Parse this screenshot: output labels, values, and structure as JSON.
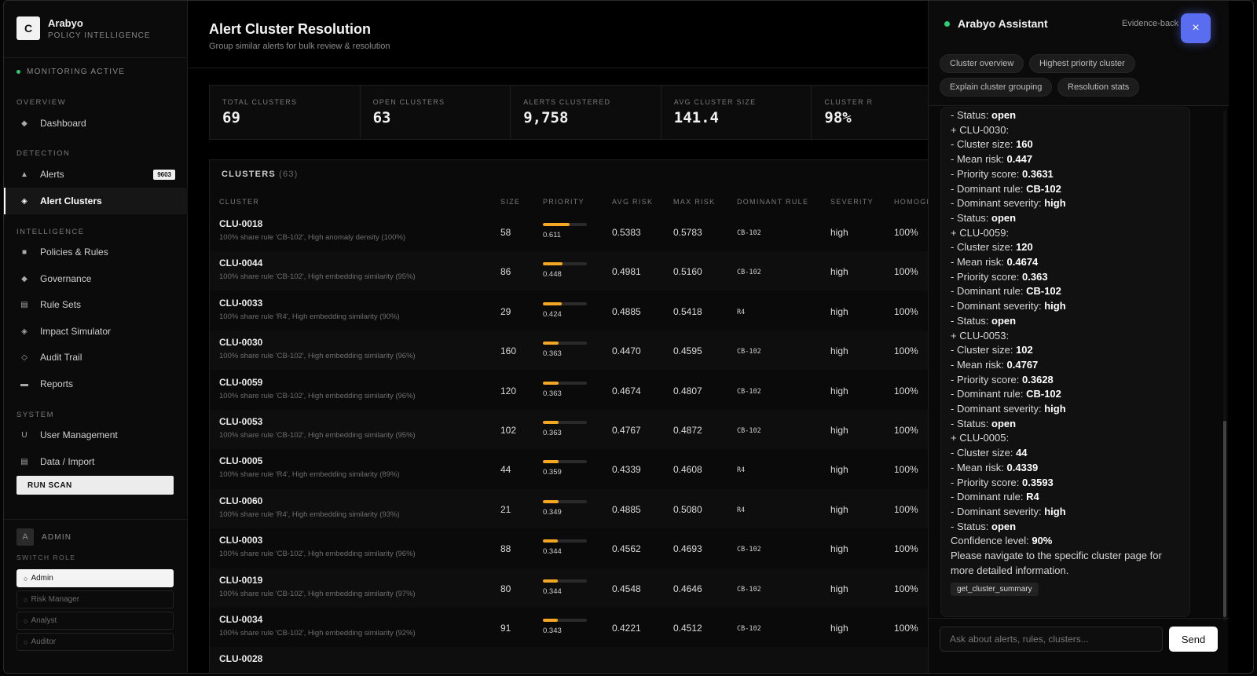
{
  "brand": {
    "logo": "C",
    "name": "Arabyo",
    "subtitle": "POLICY INTELLIGENCE"
  },
  "monitoring": "MONITORING ACTIVE",
  "nav": {
    "overview_label": "OVERVIEW",
    "detection_label": "DETECTION",
    "intelligence_label": "INTELLIGENCE",
    "system_label": "SYSTEM",
    "items": [
      {
        "label": "Dashboard",
        "icon": "◆",
        "icon_name": "diamond-icon"
      },
      {
        "label": "Alerts",
        "icon": "▲",
        "icon_name": "alert-triangle-icon",
        "badge": "9603"
      },
      {
        "label": "Alert Clusters",
        "icon": "◈",
        "icon_name": "cluster-icon"
      },
      {
        "label": "Policies & Rules",
        "icon": "■",
        "icon_name": "square-icon"
      },
      {
        "label": "Governance",
        "icon": "◆",
        "icon_name": "diamond-icon"
      },
      {
        "label": "Rule Sets",
        "icon": "▤",
        "icon_name": "list-icon"
      },
      {
        "label": "Impact Simulator",
        "icon": "◈",
        "icon_name": "simulator-icon"
      },
      {
        "label": "Audit Trail",
        "icon": "◇",
        "icon_name": "diamond-outline-icon"
      },
      {
        "label": "Reports",
        "icon": "▬",
        "icon_name": "report-icon"
      },
      {
        "label": "User Management",
        "icon": "U",
        "icon_name": "user-icon"
      },
      {
        "label": "Data / Import",
        "icon": "▤",
        "icon_name": "database-icon"
      }
    ],
    "run_scan": "RUN SCAN"
  },
  "user": {
    "avatar": "A",
    "name": "ADMIN",
    "switch_role": "SWITCH ROLE",
    "roles": [
      "Admin",
      "Risk Manager",
      "Analyst",
      "Auditor"
    ]
  },
  "page": {
    "title": "Alert Cluster Resolution",
    "subtitle": "Group similar alerts for bulk review & resolution"
  },
  "stats": [
    {
      "label": "TOTAL CLUSTERS",
      "value": "69"
    },
    {
      "label": "OPEN CLUSTERS",
      "value": "63"
    },
    {
      "label": "ALERTS CLUSTERED",
      "value": "9,758"
    },
    {
      "label": "AVG CLUSTER SIZE",
      "value": "141.4"
    },
    {
      "label": "CLUSTER R",
      "value": "98%"
    }
  ],
  "clusters": {
    "title": "CLUSTERS",
    "count": "(63)",
    "headers": [
      "CLUSTER",
      "SIZE",
      "PRIORITY",
      "AVG RISK",
      "MAX RISK",
      "DOMINANT RULE",
      "SEVERITY",
      "HOMOGE"
    ],
    "rows": [
      {
        "id": "CLU-0018",
        "desc": "100% share rule 'CB-102', High anomaly density (100%)",
        "size": "58",
        "priority": "0.611",
        "avg": "0.5383",
        "max": "0.5783",
        "rule": "CB-102",
        "sev": "high",
        "hom": "100%"
      },
      {
        "id": "CLU-0044",
        "desc": "100% share rule 'CB-102', High embedding similarity (95%)",
        "size": "86",
        "priority": "0.448",
        "avg": "0.4981",
        "max": "0.5160",
        "rule": "CB-102",
        "sev": "high",
        "hom": "100%"
      },
      {
        "id": "CLU-0033",
        "desc": "100% share rule 'R4', High embedding similarity (90%)",
        "size": "29",
        "priority": "0.424",
        "avg": "0.4885",
        "max": "0.5418",
        "rule": "R4",
        "sev": "high",
        "hom": "100%"
      },
      {
        "id": "CLU-0030",
        "desc": "100% share rule 'CB-102', High embedding similarity (96%)",
        "size": "160",
        "priority": "0.363",
        "avg": "0.4470",
        "max": "0.4595",
        "rule": "CB-102",
        "sev": "high",
        "hom": "100%"
      },
      {
        "id": "CLU-0059",
        "desc": "100% share rule 'CB-102', High embedding similarity (96%)",
        "size": "120",
        "priority": "0.363",
        "avg": "0.4674",
        "max": "0.4807",
        "rule": "CB-102",
        "sev": "high",
        "hom": "100%"
      },
      {
        "id": "CLU-0053",
        "desc": "100% share rule 'CB-102', High embedding similarity (95%)",
        "size": "102",
        "priority": "0.363",
        "avg": "0.4767",
        "max": "0.4872",
        "rule": "CB-102",
        "sev": "high",
        "hom": "100%"
      },
      {
        "id": "CLU-0005",
        "desc": "100% share rule 'R4', High embedding similarity (89%)",
        "size": "44",
        "priority": "0.359",
        "avg": "0.4339",
        "max": "0.4608",
        "rule": "R4",
        "sev": "high",
        "hom": "100%"
      },
      {
        "id": "CLU-0060",
        "desc": "100% share rule 'R4', High embedding similarity (93%)",
        "size": "21",
        "priority": "0.349",
        "avg": "0.4885",
        "max": "0.5080",
        "rule": "R4",
        "sev": "high",
        "hom": "100%"
      },
      {
        "id": "CLU-0003",
        "desc": "100% share rule 'CB-102', High embedding similarity (96%)",
        "size": "88",
        "priority": "0.344",
        "avg": "0.4562",
        "max": "0.4693",
        "rule": "CB-102",
        "sev": "high",
        "hom": "100%"
      },
      {
        "id": "CLU-0019",
        "desc": "100% share rule 'CB-102', High embedding similarity (97%)",
        "size": "80",
        "priority": "0.344",
        "avg": "0.4548",
        "max": "0.4646",
        "rule": "CB-102",
        "sev": "high",
        "hom": "100%"
      },
      {
        "id": "CLU-0034",
        "desc": "100% share rule 'CB-102', High embedding similarity (92%)",
        "size": "91",
        "priority": "0.343",
        "avg": "0.4221",
        "max": "0.4512",
        "rule": "CB-102",
        "sev": "high",
        "hom": "100%"
      },
      {
        "id": "CLU-0028",
        "desc": "",
        "size": "",
        "priority": "",
        "avg": "",
        "max": "",
        "rule": "",
        "sev": "",
        "hom": ""
      }
    ]
  },
  "assistant": {
    "title": "Arabyo Assistant",
    "subtitle": "Evidence-back",
    "close": "×",
    "chips": [
      "Cluster overview",
      "Highest priority cluster",
      "Explain cluster grouping",
      "Resolution stats"
    ],
    "lines": [
      {
        "t": "- Status: ",
        "b": "open"
      },
      {
        "t": "+ CLU-0030:",
        "b": ""
      },
      {
        "t": "- Cluster size: ",
        "b": "160"
      },
      {
        "t": "- Mean risk: ",
        "b": "0.447"
      },
      {
        "t": "- Priority score: ",
        "b": "0.3631"
      },
      {
        "t": "- Dominant rule: ",
        "b": "CB-102"
      },
      {
        "t": "- Dominant severity: ",
        "b": "high"
      },
      {
        "t": "- Status: ",
        "b": "open"
      },
      {
        "t": "+ CLU-0059:",
        "b": ""
      },
      {
        "t": "- Cluster size: ",
        "b": "120"
      },
      {
        "t": "- Mean risk: ",
        "b": "0.4674"
      },
      {
        "t": "- Priority score: ",
        "b": "0.363"
      },
      {
        "t": "- Dominant rule: ",
        "b": "CB-102"
      },
      {
        "t": "- Dominant severity: ",
        "b": "high"
      },
      {
        "t": "- Status: ",
        "b": "open"
      },
      {
        "t": "+ CLU-0053:",
        "b": ""
      },
      {
        "t": "- Cluster size: ",
        "b": "102"
      },
      {
        "t": "- Mean risk: ",
        "b": "0.4767"
      },
      {
        "t": "- Priority score: ",
        "b": "0.3628"
      },
      {
        "t": "- Dominant rule: ",
        "b": "CB-102"
      },
      {
        "t": "- Dominant severity: ",
        "b": "high"
      },
      {
        "t": "- Status: ",
        "b": "open"
      },
      {
        "t": "+ CLU-0005:",
        "b": ""
      },
      {
        "t": "- Cluster size: ",
        "b": "44"
      },
      {
        "t": "- Mean risk: ",
        "b": "0.4339"
      },
      {
        "t": "- Priority score: ",
        "b": "0.3593"
      },
      {
        "t": "- Dominant rule: ",
        "b": "R4"
      },
      {
        "t": "- Dominant severity: ",
        "b": "high"
      },
      {
        "t": "- Status: ",
        "b": "open"
      },
      {
        "t": "Confidence level: ",
        "b": "90%"
      },
      {
        "t": "Please navigate to the specific cluster page for",
        "b": ""
      },
      {
        "t": "more detailed information.",
        "b": ""
      }
    ],
    "tool_tag": "get_cluster_summary",
    "input_placeholder": "Ask about alerts, rules, clusters...",
    "send": "Send"
  },
  "colors": {
    "accent": "#f5a623",
    "status_green": "#2ecc71",
    "close_button": "#5a6cf0"
  }
}
